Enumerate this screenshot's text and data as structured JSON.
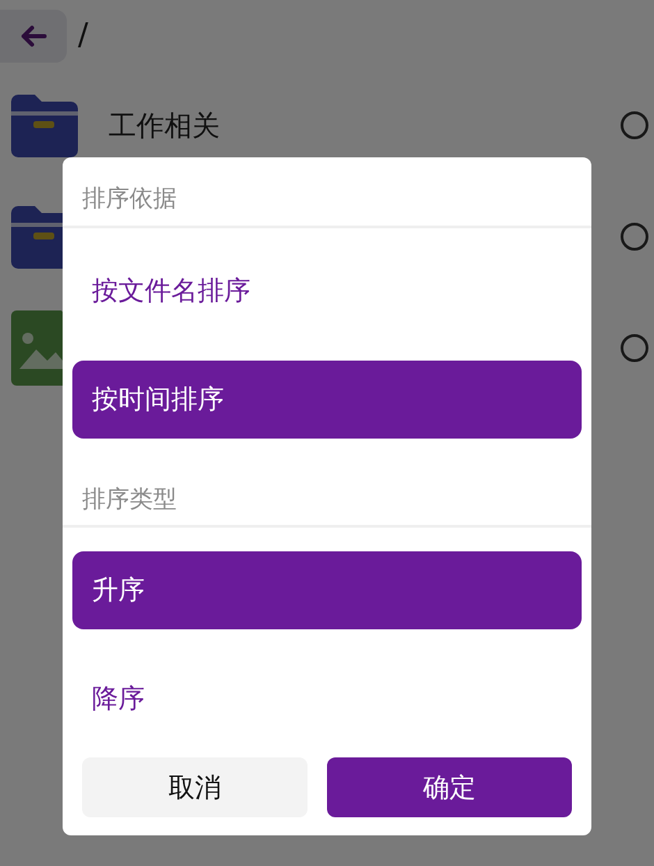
{
  "top_bar": {
    "path": "/"
  },
  "files": [
    {
      "kind": "folder",
      "name": "工作相关",
      "selected": false
    },
    {
      "kind": "folder",
      "selected": false
    },
    {
      "kind": "image",
      "selected": false
    }
  ],
  "dialog": {
    "sections": [
      {
        "title": "排序依据",
        "options": [
          {
            "label": "按文件名排序",
            "selected": false
          },
          {
            "label": "按时间排序",
            "selected": true
          }
        ]
      },
      {
        "title": "排序类型",
        "options": [
          {
            "label": "升序",
            "selected": true
          },
          {
            "label": "降序",
            "selected": false
          }
        ]
      }
    ],
    "buttons": [
      {
        "label": "取消",
        "kind": "secondary"
      },
      {
        "label": "确定",
        "kind": "primary"
      }
    ]
  }
}
